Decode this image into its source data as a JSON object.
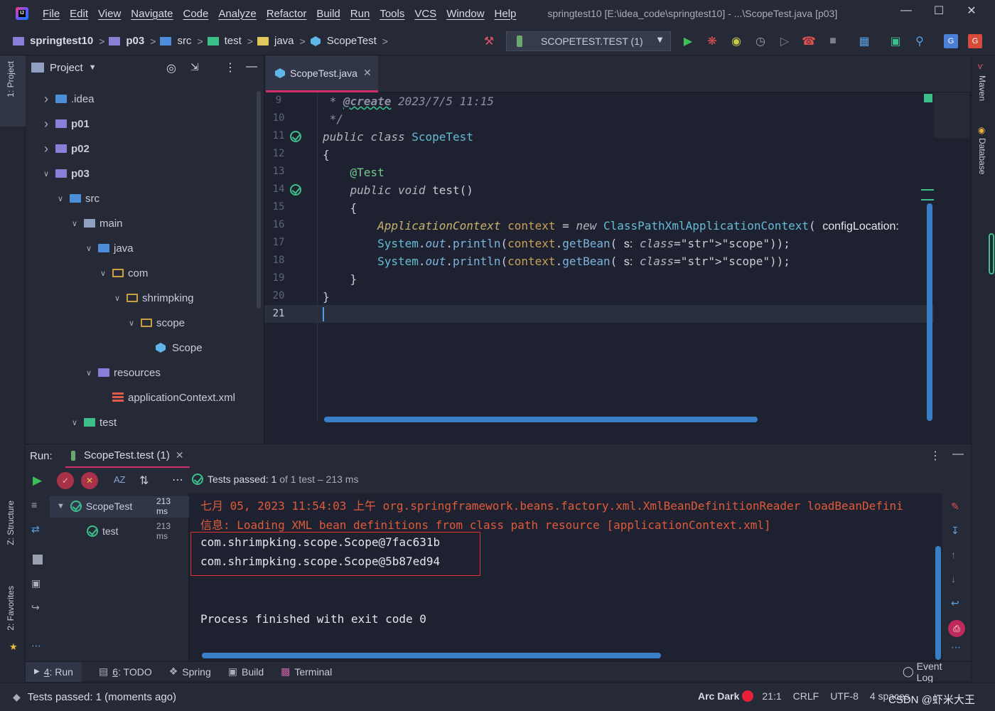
{
  "app": {
    "menu": [
      "File",
      "Edit",
      "View",
      "Navigate",
      "Code",
      "Analyze",
      "Refactor",
      "Build",
      "Run",
      "Tools",
      "VCS",
      "Window",
      "Help"
    ],
    "title": "springtest10 [E:\\idea_code\\springtest10] - ...\\ScopeTest.java [p03]"
  },
  "breadcrumb": [
    "springtest10",
    "p03",
    "src",
    "test",
    "java",
    "ScopeTest"
  ],
  "run_config": "SCOPETEST.TEST (1)",
  "project_panel": {
    "title": "Project",
    "tree": [
      {
        "label": ".idea",
        "depth": 1,
        "expanded": false,
        "icon": "folder-idea"
      },
      {
        "label": "p01",
        "depth": 1,
        "expanded": false,
        "icon": "module-folder"
      },
      {
        "label": "p02",
        "depth": 1,
        "expanded": false,
        "icon": "module-folder"
      },
      {
        "label": "p03",
        "depth": 1,
        "expanded": true,
        "icon": "module-folder"
      },
      {
        "label": "src",
        "depth": 2,
        "expanded": true,
        "icon": "src-folder"
      },
      {
        "label": "main",
        "depth": 3,
        "expanded": true,
        "icon": "folder"
      },
      {
        "label": "java",
        "depth": 4,
        "expanded": true,
        "icon": "source-folder"
      },
      {
        "label": "com",
        "depth": 5,
        "expanded": true,
        "icon": "package"
      },
      {
        "label": "shrimpking",
        "depth": 6,
        "expanded": true,
        "icon": "package"
      },
      {
        "label": "scope",
        "depth": 7,
        "expanded": true,
        "icon": "package"
      },
      {
        "label": "Scope",
        "depth": 8,
        "expanded": null,
        "icon": "class"
      },
      {
        "label": "resources",
        "depth": 4,
        "expanded": true,
        "icon": "resources-folder"
      },
      {
        "label": "applicationContext.xml",
        "depth": 5,
        "expanded": null,
        "icon": "xml-file"
      },
      {
        "label": "test",
        "depth": 3,
        "expanded": true,
        "icon": "test-folder"
      }
    ]
  },
  "editor": {
    "tab": "ScopeTest.java",
    "lines": [
      {
        "n": "9",
        "text": " * @create 2023/7/5 11:15"
      },
      {
        "n": "10",
        "text": " */"
      },
      {
        "n": "11",
        "text": "public class ScopeTest"
      },
      {
        "n": "12",
        "text": "{"
      },
      {
        "n": "13",
        "text": "    @Test"
      },
      {
        "n": "14",
        "text": "    public void test()"
      },
      {
        "n": "15",
        "text": "    {"
      },
      {
        "n": "16",
        "text": "        ApplicationContext context = new ClassPathXmlApplicationContext( configLocation:"
      },
      {
        "n": "17",
        "text": "        System.out.println(context.getBean( s: \"scope\"));"
      },
      {
        "n": "18",
        "text": "        System.out.println(context.getBean( s: \"scope\"));"
      },
      {
        "n": "19",
        "text": "    }"
      },
      {
        "n": "20",
        "text": "}"
      },
      {
        "n": "21",
        "text": ""
      }
    ]
  },
  "run_panel": {
    "label": "Run:",
    "tab": "ScopeTest.test (1)",
    "status_prefix": "Tests passed:",
    "status_count": "1",
    "status_suffix": "of 1 test – 213 ms",
    "tree": [
      {
        "label": "ScopeTest",
        "time": "213 ms"
      },
      {
        "label": "test",
        "time": "213 ms"
      }
    ],
    "console": [
      {
        "text": "七月 05, 2023 11:54:03 上午 org.springframework.beans.factory.xml.XmlBeanDefinitionReader loadBeanDefini",
        "kind": "log"
      },
      {
        "text": "信息: Loading XML bean definitions from class path resource [applicationContext.xml]",
        "kind": "log"
      },
      {
        "text": "com.shrimpking.scope.Scope@7fac631b",
        "kind": "out"
      },
      {
        "text": "com.shrimpking.scope.Scope@5b87ed94",
        "kind": "out"
      },
      {
        "text": "Process finished with exit code 0",
        "kind": "out"
      }
    ]
  },
  "tool_tabs": [
    {
      "key": "4",
      "label": ": Run"
    },
    {
      "key": "6",
      "label": ": TODO"
    },
    {
      "key": "",
      "label": "Spring"
    },
    {
      "key": "",
      "label": "Build"
    },
    {
      "key": "",
      "label": "Terminal"
    }
  ],
  "event_log": "Event Log",
  "left_tabs": [
    "1: Project",
    "Z: Structure",
    "2: Favorites"
  ],
  "right_tabs": [
    "Maven",
    "Database"
  ],
  "status": {
    "message": "Tests passed: 1 (moments ago)",
    "theme": "Arc Dark",
    "position": "21:1",
    "line_sep": "CRLF",
    "encoding": "UTF-8",
    "indent": "4 spaces",
    "watermark": "CSDN @虾米大王"
  },
  "colors": {
    "accent": "#d0306a",
    "pass": "#3cbf8b",
    "log": "#e05a3a"
  }
}
